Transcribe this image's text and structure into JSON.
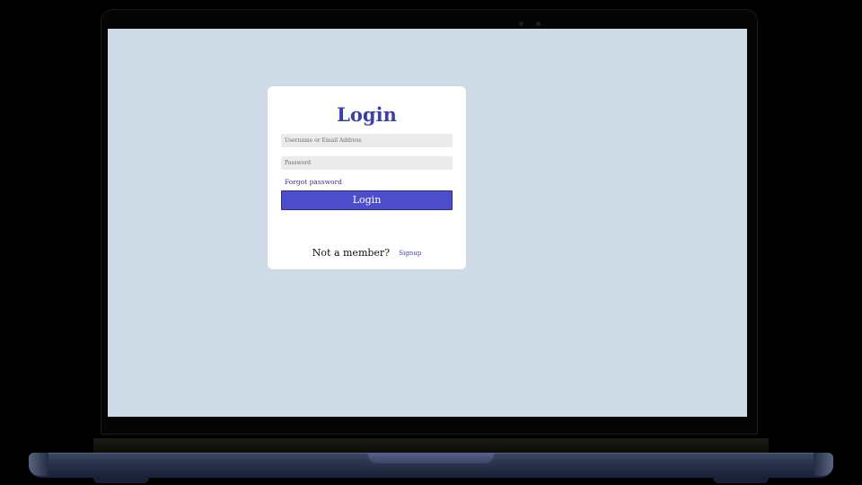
{
  "login": {
    "title": "Login",
    "username_placeholder": "Username or Email Address",
    "password_placeholder": "Password",
    "forgot_password": "Forgot password",
    "submit_label": "Login",
    "not_member_text": "Not a member?",
    "signup_label": "Signup"
  },
  "colors": {
    "screen_background": "#cfdce8",
    "accent": "#4d4ecb",
    "title": "#3d3fae",
    "link": "#4a2b8f"
  }
}
